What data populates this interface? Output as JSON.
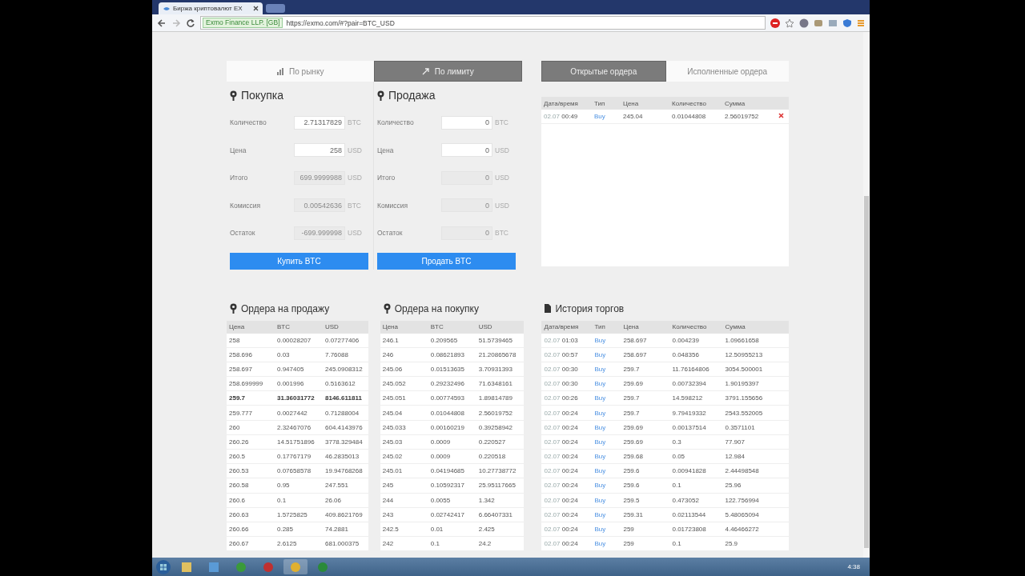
{
  "browser": {
    "tab_title": "Биржа криптовалют EX",
    "site_identity": "Exmo Finance LLP. [GB]",
    "url": "https://exmo.com/#?pair=BTC_USD"
  },
  "order_type_tabs": [
    {
      "label": "По рынку",
      "kind": "market",
      "selected": false
    },
    {
      "label": "По лимиту",
      "kind": "limit",
      "selected": true
    }
  ],
  "buy_form": {
    "title": "Покупка",
    "fields": [
      {
        "label": "Количество",
        "value": "2.71317829",
        "unit": "BTC",
        "disabled": false
      },
      {
        "label": "Цена",
        "value": "258",
        "unit": "USD",
        "disabled": false
      },
      {
        "label": "Итого",
        "value": "699.9999988",
        "unit": "USD",
        "disabled": true
      },
      {
        "label": "Комиссия",
        "value": "0.00542636",
        "unit": "BTC",
        "disabled": true
      },
      {
        "label": "Остаток",
        "value": "-699.999998",
        "unit": "USD",
        "disabled": true
      }
    ],
    "button": "Купить BTC"
  },
  "sell_form": {
    "title": "Продажа",
    "fields": [
      {
        "label": "Количество",
        "value": "0",
        "unit": "BTC",
        "disabled": false
      },
      {
        "label": "Цена",
        "value": "0",
        "unit": "USD",
        "disabled": false
      },
      {
        "label": "Итого",
        "value": "0",
        "unit": "USD",
        "disabled": true
      },
      {
        "label": "Комиссия",
        "value": "0",
        "unit": "USD",
        "disabled": true
      },
      {
        "label": "Остаток",
        "value": "0",
        "unit": "BTC",
        "disabled": true
      }
    ],
    "button": "Продать BTC"
  },
  "orders_tabs": [
    {
      "label": "Открытые ордера",
      "selected": true
    },
    {
      "label": "Исполненные ордера",
      "selected": false
    }
  ],
  "open_orders": {
    "columns": [
      "Дата/время",
      "Тип",
      "Цена",
      "Количество",
      "Сумма"
    ],
    "rows": [
      {
        "date": "02.07",
        "time": "00:49",
        "type": "Buy",
        "price": "245.04",
        "quantity": "0.01044808",
        "sum": "2.56019752"
      }
    ]
  },
  "sell_orders": {
    "title": "Ордера на продажу",
    "columns": [
      "Цена",
      "BTC",
      "USD"
    ],
    "rows": [
      {
        "cells": [
          "258",
          "0.00028207",
          "0.07277406"
        ],
        "bold": false
      },
      {
        "cells": [
          "258.696",
          "0.03",
          "7.76088"
        ],
        "bold": false
      },
      {
        "cells": [
          "258.697",
          "0.947405",
          "245.0908312"
        ],
        "bold": false
      },
      {
        "cells": [
          "258.699999",
          "0.001996",
          "0.5163612"
        ],
        "bold": false
      },
      {
        "cells": [
          "259.7",
          "31.36031772",
          "8146.611811"
        ],
        "bold": true
      },
      {
        "cells": [
          "259.777",
          "0.0027442",
          "0.71288004"
        ],
        "bold": false
      },
      {
        "cells": [
          "260",
          "2.32467076",
          "604.4143976"
        ],
        "bold": false
      },
      {
        "cells": [
          "260.26",
          "14.51751896",
          "3778.329484"
        ],
        "bold": false
      },
      {
        "cells": [
          "260.5",
          "0.17767179",
          "46.2835013"
        ],
        "bold": false
      },
      {
        "cells": [
          "260.53",
          "0.07658578",
          "19.94768268"
        ],
        "bold": false
      },
      {
        "cells": [
          "260.58",
          "0.95",
          "247.551"
        ],
        "bold": false
      },
      {
        "cells": [
          "260.6",
          "0.1",
          "26.06"
        ],
        "bold": false
      },
      {
        "cells": [
          "260.63",
          "1.5725825",
          "409.8621769"
        ],
        "bold": false
      },
      {
        "cells": [
          "260.66",
          "0.285",
          "74.2881"
        ],
        "bold": false
      },
      {
        "cells": [
          "260.67",
          "2.6125",
          "681.000375"
        ],
        "bold": false
      }
    ]
  },
  "buy_orders": {
    "title": "Ордера на покупку",
    "columns": [
      "Цена",
      "BTC",
      "USD"
    ],
    "rows": [
      {
        "cells": [
          "246.1",
          "0.209565",
          "51.5739465"
        ],
        "bold": false
      },
      {
        "cells": [
          "246",
          "0.08621893",
          "21.20865678"
        ],
        "bold": false
      },
      {
        "cells": [
          "245.06",
          "0.01513635",
          "3.70931393"
        ],
        "bold": false
      },
      {
        "cells": [
          "245.052",
          "0.29232496",
          "71.6348161"
        ],
        "bold": false
      },
      {
        "cells": [
          "245.051",
          "0.00774593",
          "1.89814789"
        ],
        "bold": false
      },
      {
        "cells": [
          "245.04",
          "0.01044808",
          "2.56019752"
        ],
        "bold": false
      },
      {
        "cells": [
          "245.033",
          "0.00160219",
          "0.39258942"
        ],
        "bold": false
      },
      {
        "cells": [
          "245.03",
          "0.0009",
          "0.220527"
        ],
        "bold": false
      },
      {
        "cells": [
          "245.02",
          "0.0009",
          "0.220518"
        ],
        "bold": false
      },
      {
        "cells": [
          "245.01",
          "0.04194685",
          "10.27738772"
        ],
        "bold": false
      },
      {
        "cells": [
          "245",
          "0.10592317",
          "25.95117665"
        ],
        "bold": false
      },
      {
        "cells": [
          "244",
          "0.0055",
          "1.342"
        ],
        "bold": false
      },
      {
        "cells": [
          "243",
          "0.02742417",
          "6.66407331"
        ],
        "bold": false
      },
      {
        "cells": [
          "242.5",
          "0.01",
          "2.425"
        ],
        "bold": false
      },
      {
        "cells": [
          "242",
          "0.1",
          "24.2"
        ],
        "bold": false
      }
    ]
  },
  "trade_history": {
    "title": "История торгов",
    "columns": [
      "Дата/время",
      "Тип",
      "Цена",
      "Количество",
      "Сумма"
    ],
    "rows": [
      {
        "date": "02.07",
        "time": "01:03",
        "type": "Buy",
        "price": "258.697",
        "quantity": "0.004239",
        "sum": "1.09661658"
      },
      {
        "date": "02.07",
        "time": "00:57",
        "type": "Buy",
        "price": "258.697",
        "quantity": "0.048356",
        "sum": "12.50955213"
      },
      {
        "date": "02.07",
        "time": "00:30",
        "type": "Buy",
        "price": "259.7",
        "quantity": "11.76164806",
        "sum": "3054.500001"
      },
      {
        "date": "02.07",
        "time": "00:30",
        "type": "Buy",
        "price": "259.69",
        "quantity": "0.00732394",
        "sum": "1.90195397"
      },
      {
        "date": "02.07",
        "time": "00:26",
        "type": "Buy",
        "price": "259.7",
        "quantity": "14.598212",
        "sum": "3791.155656"
      },
      {
        "date": "02.07",
        "time": "00:24",
        "type": "Buy",
        "price": "259.7",
        "quantity": "9.79419332",
        "sum": "2543.552005"
      },
      {
        "date": "02.07",
        "time": "00:24",
        "type": "Buy",
        "price": "259.69",
        "quantity": "0.00137514",
        "sum": "0.3571101"
      },
      {
        "date": "02.07",
        "time": "00:24",
        "type": "Buy",
        "price": "259.69",
        "quantity": "0.3",
        "sum": "77.907"
      },
      {
        "date": "02.07",
        "time": "00:24",
        "type": "Buy",
        "price": "259.68",
        "quantity": "0.05",
        "sum": "12.984"
      },
      {
        "date": "02.07",
        "time": "00:24",
        "type": "Buy",
        "price": "259.6",
        "quantity": "0.00941828",
        "sum": "2.44498548"
      },
      {
        "date": "02.07",
        "time": "00:24",
        "type": "Buy",
        "price": "259.6",
        "quantity": "0.1",
        "sum": "25.96"
      },
      {
        "date": "02.07",
        "time": "00:24",
        "type": "Buy",
        "price": "259.5",
        "quantity": "0.473052",
        "sum": "122.756994"
      },
      {
        "date": "02.07",
        "time": "00:24",
        "type": "Buy",
        "price": "259.31",
        "quantity": "0.02113544",
        "sum": "5.48065094"
      },
      {
        "date": "02.07",
        "time": "00:24",
        "type": "Buy",
        "price": "259",
        "quantity": "0.01723808",
        "sum": "4.46466272"
      },
      {
        "date": "02.07",
        "time": "00:24",
        "type": "Buy",
        "price": "259",
        "quantity": "0.1",
        "sum": "25.9"
      }
    ]
  },
  "taskbar": {
    "clock": "4:38"
  }
}
